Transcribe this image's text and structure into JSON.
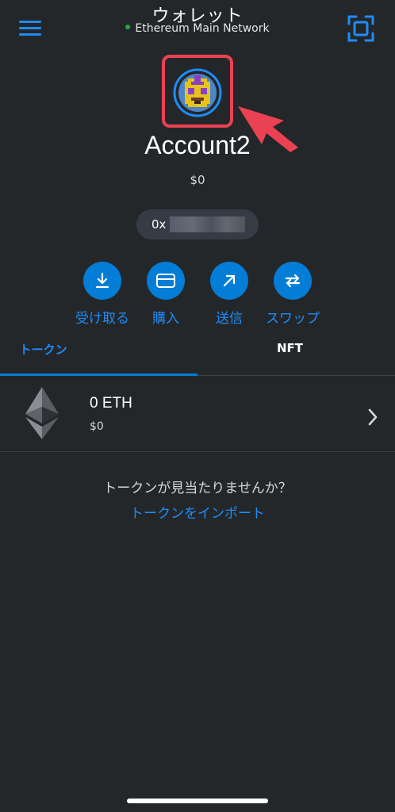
{
  "header": {
    "title": "ウォレット",
    "network": "Ethereum Main Network",
    "network_status_color": "#28a745",
    "menu_icon": "hamburger-menu-icon",
    "scan_icon": "qr-scan-icon"
  },
  "account": {
    "name": "Account2",
    "balance": "$0",
    "address_prefix": "0x",
    "avatar_icon": "pixel-avatar-icon"
  },
  "actions": [
    {
      "label": "受け取る",
      "icon": "receive-icon"
    },
    {
      "label": "購入",
      "icon": "buy-card-icon"
    },
    {
      "label": "送信",
      "icon": "send-arrow-icon"
    },
    {
      "label": "スワップ",
      "icon": "swap-icon"
    }
  ],
  "tabs": [
    {
      "label": "トークン",
      "active": true
    },
    {
      "label": "NFT",
      "active": false
    }
  ],
  "tokens": [
    {
      "amount": "0 ETH",
      "fiat": "$0",
      "icon": "ethereum-icon"
    }
  ],
  "empty_state": {
    "message": "トークンが見当たりませんか？",
    "link": "トークンをインポート"
  },
  "colors": {
    "background": "#24272a",
    "accent": "#037dd6",
    "link": "#1f8cf6",
    "highlight": "#ea4153"
  }
}
